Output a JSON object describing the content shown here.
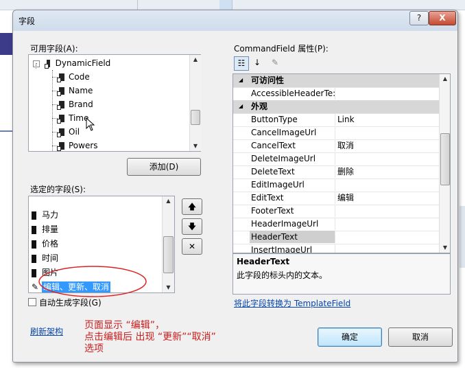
{
  "dialog": {
    "title": "字段",
    "help_glyph": "?",
    "close_glyph": "X"
  },
  "available": {
    "label": "可用字段(A):",
    "root": "DynamicField",
    "items": [
      "Code",
      "Name",
      "Brand",
      "Time",
      "Oil",
      "Powers"
    ]
  },
  "add_button": "添加(D)",
  "selected": {
    "label": "选定的字段(S):",
    "items": [
      "马力",
      "排量",
      "价格",
      "时间",
      "图片",
      "编辑、更新、取消",
      "编辑"
    ]
  },
  "auto_generate": {
    "label": "自动生成字段(G)",
    "checked": false
  },
  "refresh_link": "刷新架构",
  "properties": {
    "label": "CommandField 属性(P):",
    "toolbar_icons": [
      "categorized-icon",
      "alphabetical-icon",
      "property-pages-icon"
    ],
    "rows": [
      {
        "type": "category",
        "name": "可访问性"
      },
      {
        "type": "prop",
        "name": "AccessibleHeaderTe:",
        "value": ""
      },
      {
        "type": "category",
        "name": "外观"
      },
      {
        "type": "prop",
        "name": "ButtonType",
        "value": "Link"
      },
      {
        "type": "prop",
        "name": "CancelImageUrl",
        "value": ""
      },
      {
        "type": "prop",
        "name": "CancelText",
        "value": "取消"
      },
      {
        "type": "prop",
        "name": "DeleteImageUrl",
        "value": ""
      },
      {
        "type": "prop",
        "name": "DeleteText",
        "value": "删除"
      },
      {
        "type": "prop",
        "name": "EditImageUrl",
        "value": ""
      },
      {
        "type": "prop",
        "name": "EditText",
        "value": "编辑"
      },
      {
        "type": "prop",
        "name": "FooterText",
        "value": ""
      },
      {
        "type": "prop",
        "name": "HeaderImageUrl",
        "value": ""
      },
      {
        "type": "prop",
        "name": "HeaderText",
        "value": "",
        "highlighted": true
      },
      {
        "type": "prop",
        "name": "InsertImageUrl",
        "value": ""
      }
    ],
    "description_title": "HeaderText",
    "description_text": "此字段的标头内的文本。"
  },
  "convert_link": "将此字段转换为 TemplateField",
  "ok_button": "确定",
  "cancel_button": "取消",
  "annotation": {
    "line1": "页面显示 “编辑”，",
    "line2": "点击编辑后 出现 “更新”“取消”",
    "line3": "选项"
  },
  "colors": {
    "annotation_red": "#cc1c1c",
    "link_blue": "#0645ad"
  }
}
